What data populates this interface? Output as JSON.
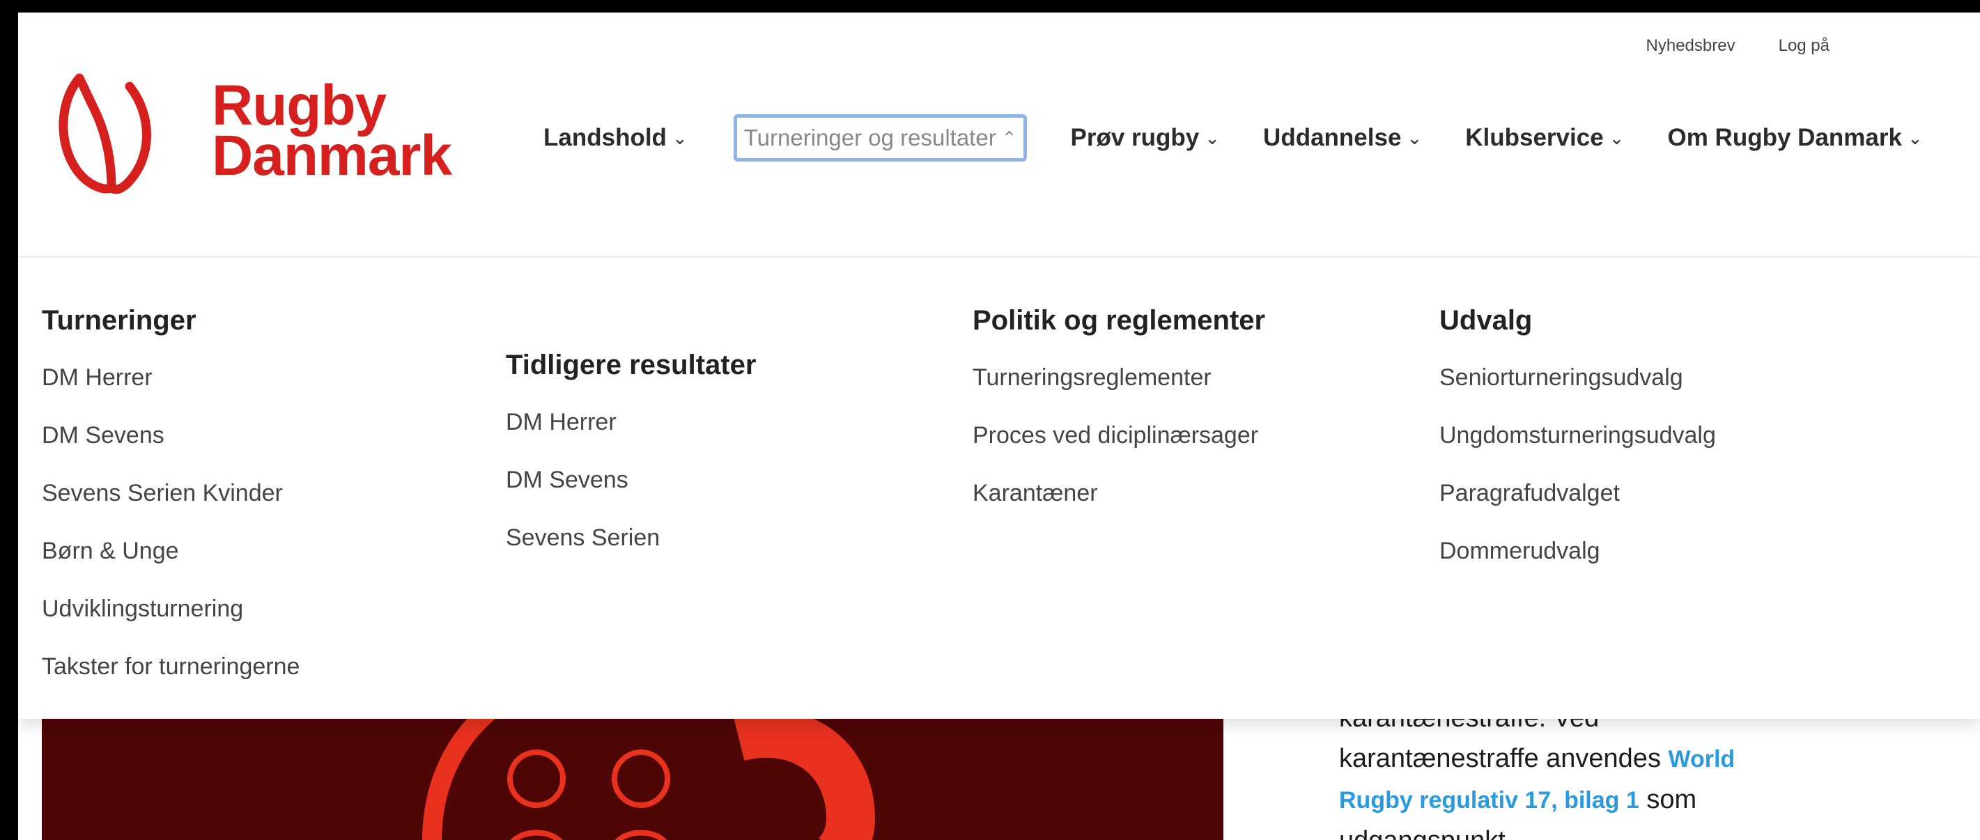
{
  "util_nav": {
    "newsletter": "Nyhedsbrev",
    "login": "Log på"
  },
  "logo": {
    "line1": "Rugby",
    "line2": "Danmark"
  },
  "main_nav": [
    {
      "label": "Landshold"
    },
    {
      "label": "Turneringer og resultater",
      "active": true
    },
    {
      "label": "Prøv rugby"
    },
    {
      "label": "Uddannelse"
    },
    {
      "label": "Klubservice"
    },
    {
      "label": "Om Rugby Danmark"
    }
  ],
  "mega_menu": {
    "columns": [
      {
        "heading": "Turneringer",
        "links": [
          "DM Herrer",
          "DM Sevens",
          "Sevens Serien Kvinder",
          "Børn & Unge",
          "Udviklingsturnering",
          "Takster for turneringerne"
        ]
      },
      {
        "heading": "Tidligere resultater",
        "links": [
          "DM Herrer",
          "DM Sevens",
          "Sevens Serien"
        ]
      },
      {
        "heading": "Politik og reglementer",
        "links": [
          "Turneringsreglementer",
          "Proces ved diciplinærsager",
          "Karantæner"
        ]
      },
      {
        "heading": "Udvalg",
        "links": [
          "Seniorturneringsudvalg",
          "Ungdomsturneringsudvalg",
          "Paragrafudvalget",
          "Dommerudvalg"
        ]
      }
    ]
  },
  "body": {
    "line1": "karantænestraffe. Ved",
    "line2_pre": "karantænestraffe anvendes ",
    "line2_link": "World",
    "line3_link": "Rugby regulativ 17, bilag 1",
    "line3_post": " som",
    "line4": "udgangspunkt."
  },
  "colors": {
    "brand": "#d6201d",
    "link": "#2a9ae0",
    "focus": "#8fb2ea",
    "hero_bg": "#4d0506"
  },
  "icons": {
    "dropdown": "chevron-down-icon",
    "dropdown_open": "chevron-up-icon"
  }
}
